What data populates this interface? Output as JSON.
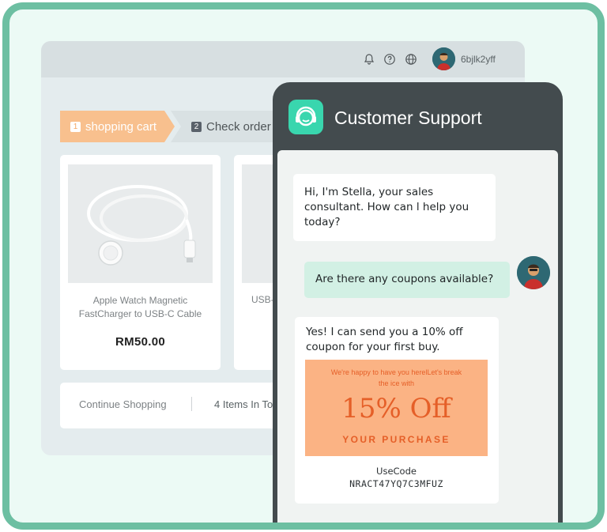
{
  "header": {
    "username": "6bjlk2yff"
  },
  "steps": [
    {
      "number": "1",
      "label": "shopping cart"
    },
    {
      "number": "2",
      "label": "Check order"
    }
  ],
  "products": [
    {
      "name": "Apple Watch Magnetic FastCharger to USB-C Cable",
      "price": "RM50.00"
    },
    {
      "name": "USB-"
    }
  ],
  "footer": {
    "continue": "Continue Shopping",
    "items": "4 Items In To"
  },
  "chat": {
    "title": "Customer Support",
    "messages": {
      "bot_greeting": "Hi, I'm Stella, your sales consultant. How can l help you today?",
      "user_question": "Are there any coupons available?",
      "bot_reply": "Yes! I can send you a 10% off coupon for your first buy."
    },
    "coupon": {
      "message": "We're happy to have you herelLet's break the ice with",
      "discount": "15% Off",
      "subtitle": "YOUR PURCHASE",
      "code_label": "UseCode",
      "code": "NRACT47YQ7C3MFUZ"
    }
  },
  "colors": {
    "frame": "#6dbfa2",
    "accent_mint": "#39d6ae",
    "step_active": "#f8c08e",
    "coupon_bg": "#fbb384",
    "coupon_text": "#e55f28",
    "chat_dark": "#434b4e"
  },
  "icons": [
    "bell-icon",
    "help-icon",
    "globe-icon",
    "support-agent-icon"
  ]
}
